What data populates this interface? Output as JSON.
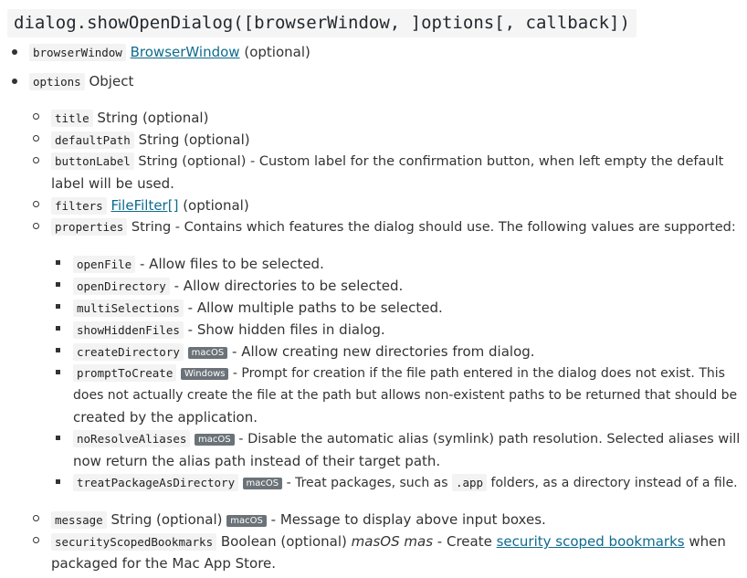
{
  "heading": "dialog.showOpenDialog([browserWindow, ]options[, callback])",
  "params": {
    "browserWindow": {
      "name": "browserWindow",
      "type_link": "BrowserWindow",
      "suffix": "(optional)"
    },
    "options": {
      "name": "options",
      "type": "Object"
    }
  },
  "options_list": {
    "title": {
      "name": "title",
      "text": "String (optional)"
    },
    "defaultPath": {
      "name": "defaultPath",
      "text": "String (optional)"
    },
    "buttonLabel": {
      "name": "buttonLabel",
      "text": "String (optional) - Custom label for the confirmation button, when left empty the default",
      "text2": "label will be used."
    },
    "filters": {
      "name": "filters",
      "type_link": "FileFilter[]",
      "suffix": "(optional)"
    },
    "properties": {
      "name": "properties",
      "text": "String - Contains which features the dialog should use. The following values are supported:"
    },
    "message": {
      "name": "message",
      "type": "String (optional)",
      "tag": "macOS",
      "text": "- Message to display above input boxes."
    },
    "securityScopedBookmarks": {
      "name": "securityScopedBookmarks",
      "type": "Boolean (optional)",
      "platform": "masOS mas",
      "pre": "- Create",
      "link": "security scoped bookmarks",
      "post": "when",
      "text2": "packaged for the Mac App Store."
    }
  },
  "properties_list": {
    "openFile": {
      "name": "openFile",
      "text": "- Allow files to be selected."
    },
    "openDirectory": {
      "name": "openDirectory",
      "text": "- Allow directories to be selected."
    },
    "multiSelections": {
      "name": "multiSelections",
      "text": "- Allow multiple paths to be selected."
    },
    "showHiddenFiles": {
      "name": "showHiddenFiles",
      "text": "- Show hidden files in dialog."
    },
    "createDirectory": {
      "name": "createDirectory",
      "tag": "macOS",
      "text": "- Allow creating new directories from dialog."
    },
    "promptToCreate": {
      "name": "promptToCreate",
      "tag": "Windows",
      "text": "- Prompt for creation if the file path entered in the dialog does not exist. This",
      "text2": "does not actually create the file at the path but allows non-existent paths to be returned that should be",
      "text3": "created by the application."
    },
    "noResolveAliases": {
      "name": "noResolveAliases",
      "tag": "macOS",
      "text": "- Disable the automatic alias (symlink) path resolution. Selected aliases will",
      "text2": "now return the alias path instead of their target path."
    },
    "treatPackageAsDirectory": {
      "name": "treatPackageAsDirectory",
      "tag": "macOS",
      "pre": "- Treat packages, such as",
      "code": ".app",
      "post": "folders, as a directory instead of a file."
    }
  }
}
